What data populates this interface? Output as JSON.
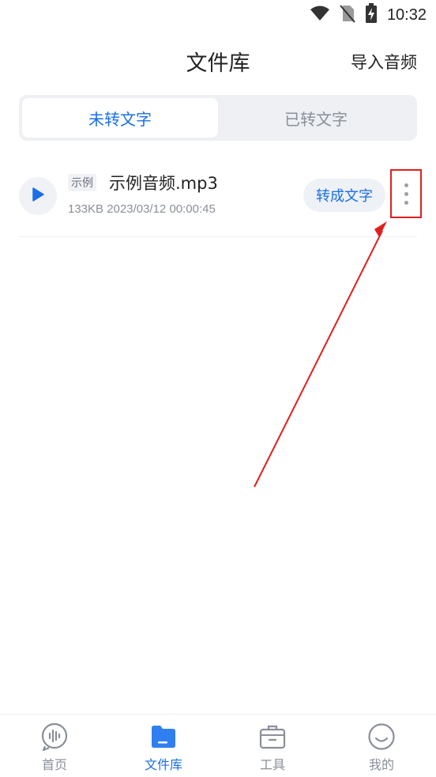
{
  "status_bar": {
    "time": "10:32",
    "icons": [
      "wifi-icon",
      "no-sim-icon",
      "battery-charging-icon"
    ]
  },
  "header": {
    "title": "文件库",
    "action_label": "导入音频"
  },
  "segment": {
    "tabs": [
      {
        "label": "未转文字",
        "active": true
      },
      {
        "label": "已转文字",
        "active": false
      }
    ]
  },
  "files": [
    {
      "badge": "示例",
      "name": "示例音频.mp3",
      "meta": "133KB 2023/03/12 00:00:45",
      "convert_label": "转成文字",
      "icons": [
        "play-icon",
        "more-vertical-icon"
      ]
    }
  ],
  "bottom_nav": {
    "items": [
      {
        "label": "首页",
        "icon": "voice-wave-icon",
        "active": false
      },
      {
        "label": "文件库",
        "icon": "folder-icon",
        "active": true
      },
      {
        "label": "工具",
        "icon": "toolbox-icon",
        "active": false
      },
      {
        "label": "我的",
        "icon": "smile-face-icon",
        "active": false
      }
    ]
  },
  "colors": {
    "accent": "#1a6fe8",
    "annotation": "#e21f1f",
    "muted_text": "#8a8f99"
  }
}
